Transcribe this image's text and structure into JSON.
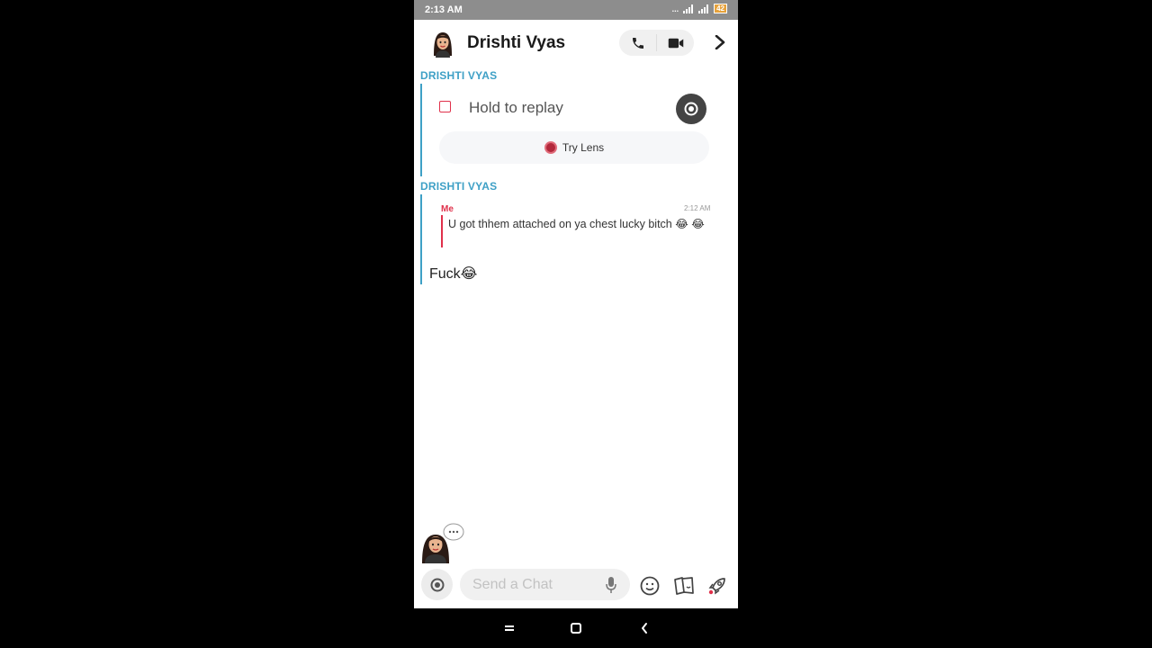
{
  "status_bar": {
    "time": "2:13 AM",
    "network": "...",
    "battery": "42"
  },
  "header": {
    "contact_name": "Drishti Vyas"
  },
  "messages": {
    "snap_sender": "DRISHTI VYAS",
    "snap_status": "Hold to replay",
    "try_lens": "Try Lens",
    "reply_sender": "DRISHTI VYAS",
    "quote_sender": "Me",
    "quote_time": "2:12 AM",
    "quote_text": "U got thhem attached on ya chest lucky bitch 😂 😂",
    "reply_text": "Fuck😂"
  },
  "composer": {
    "placeholder": "Send a Chat"
  },
  "colors": {
    "accent_blue": "#3ea0c6",
    "accent_red": "#e0314b",
    "background": "#ffffff"
  },
  "icons": [
    "phone-icon",
    "video-icon",
    "chevron-right-icon",
    "camera-icon",
    "mic-icon",
    "smiley-icon",
    "sticker-icon",
    "rocket-icon"
  ]
}
